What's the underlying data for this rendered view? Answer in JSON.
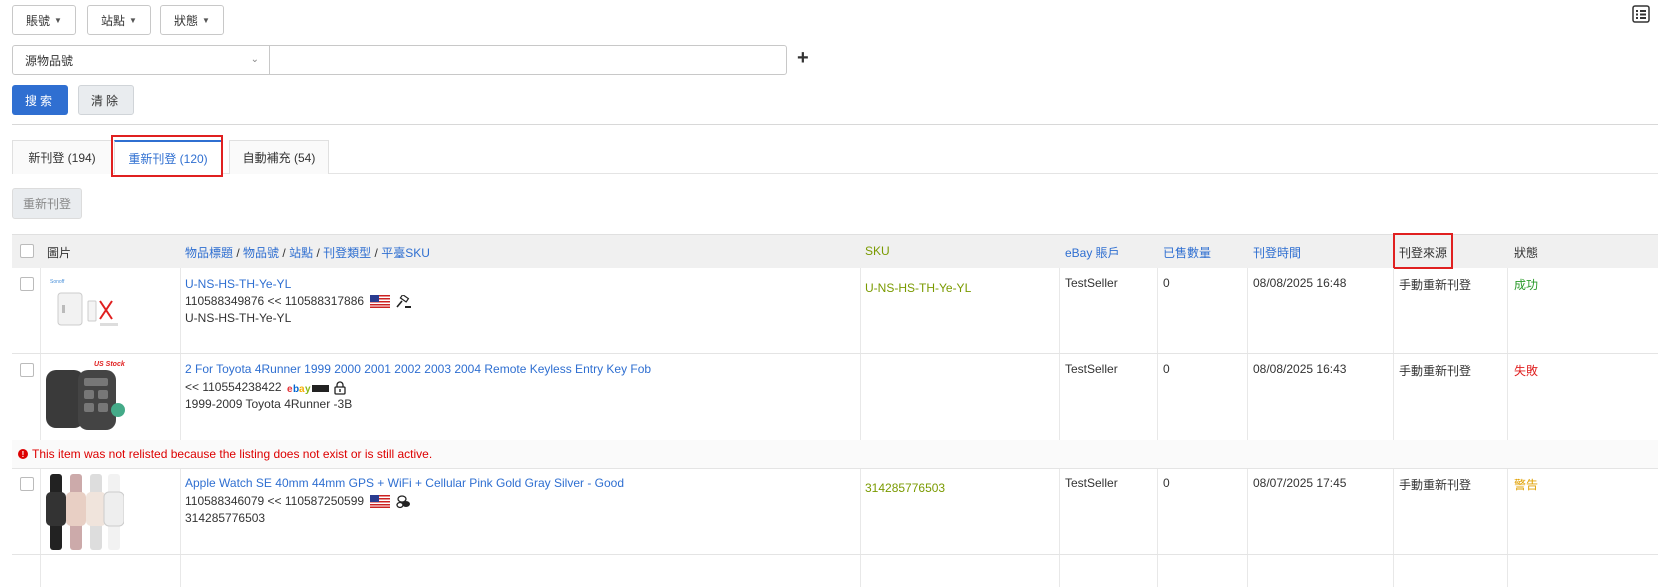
{
  "filters": {
    "account_label": "賬號",
    "site_label": "站點",
    "status_label": "狀態",
    "field_select_value": "源物品號",
    "field_input_value": "",
    "add_symbol": "+"
  },
  "buttons": {
    "search": "搜索",
    "clear": "清除",
    "relist": "重新刊登"
  },
  "tabs": [
    {
      "label": "新刊登 (194)"
    },
    {
      "label": "重新刊登 (120)"
    },
    {
      "label": "自動補充 (54)"
    }
  ],
  "table": {
    "headers": {
      "image": "圖片",
      "title_part1": "物品標題",
      "sep": "/",
      "title_part2": "物品號",
      "title_part3": "站點",
      "title_part4": "刊登類型",
      "title_part5": "平臺SKU",
      "sku": "SKU",
      "account": "eBay 賬戶",
      "sold": "已售數量",
      "time": "刊登時間",
      "source": "刊登來源",
      "status": "狀態"
    },
    "rows": [
      {
        "image_caption": "Sonoff",
        "title": "U-NS-HS-TH-Ye-YL",
        "item_line": "110588349876 << 110588317886",
        "platform_sku": "U-NS-HS-TH-Ye-YL",
        "sku": "U-NS-HS-TH-Ye-YL",
        "account": "TestSeller",
        "sold": "0",
        "time": "08/08/2025 16:48",
        "source": "手動重新刊登",
        "status": "成功"
      },
      {
        "image_caption": "US Stock",
        "title": "2 For Toyota 4Runner 1999 2000 2001 2002 2003 2004 Remote Keyless Entry Key Fob",
        "item_line": "<< 110554238422",
        "platform_sku": "1999-2009 Toyota 4Runner -3B",
        "sku": "",
        "account": "TestSeller",
        "sold": "0",
        "time": "08/08/2025 16:43",
        "source": "手動重新刊登",
        "status": "失敗",
        "error": "This item was not relisted because the listing does not exist or is still active."
      },
      {
        "title": "Apple Watch SE 40mm 44mm GPS + WiFi + Cellular Pink Gold Gray Silver - Good",
        "item_line": "110588346079 << 110587250599",
        "platform_sku": "314285776503",
        "sku": "314285776503",
        "account": "TestSeller",
        "sold": "0",
        "time": "08/07/2025 17:45",
        "source": "手動重新刊登",
        "status": "警告"
      }
    ]
  },
  "colors": {
    "accent": "#2f6fd1",
    "success": "#2a9a2a",
    "fail": "#e02020",
    "warn": "#e0a000",
    "sku": "#7a9a00",
    "highlight": "#e02020"
  },
  "icons": [
    "chevron-down-icon",
    "list-menu-icon",
    "plus-icon",
    "us-flag-icon",
    "gavel-icon",
    "ebay-motors-icon",
    "lock-icon",
    "coins-icon",
    "error-icon"
  ]
}
